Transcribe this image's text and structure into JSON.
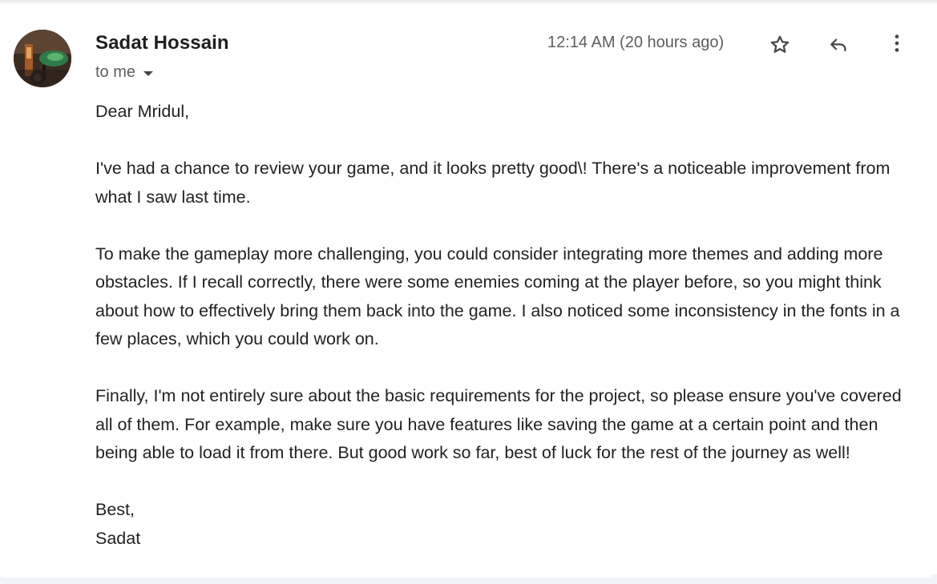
{
  "sender": {
    "name": "Sadat Hossain",
    "recipient_label": "to me"
  },
  "timestamp": "12:14 AM (20 hours ago)",
  "actions": {
    "star_icon": "star-outline-icon",
    "reply_icon": "reply-icon",
    "more_icon": "more-vertical-icon"
  },
  "message": {
    "greeting": "Dear Mridul,",
    "paragraphs": [
      "I've had a chance to review your game, and it looks pretty good\\! There's a noticeable improvement from what I saw last time.",
      "To make the gameplay more challenging, you could consider integrating more themes and adding more obstacles. If I recall correctly, there were some enemies coming at the player before, so you might think about how to effectively bring them back into the game. I also noticed some inconsistency in the fonts in a few places, which you could work on.",
      "Finally, I'm not entirely sure about the basic requirements for the project, so please ensure you've covered all of them. For example, make sure you have features like saving the game at a certain point and then being able to load it from there. But good work so far, best of luck for the rest of the journey as well!"
    ],
    "signoff": "Best,",
    "signature": "Sadat"
  },
  "colors": {
    "text_primary": "#1f1f1f",
    "text_secondary": "#5e5e5e",
    "icon": "#444746",
    "background": "#ffffff"
  }
}
